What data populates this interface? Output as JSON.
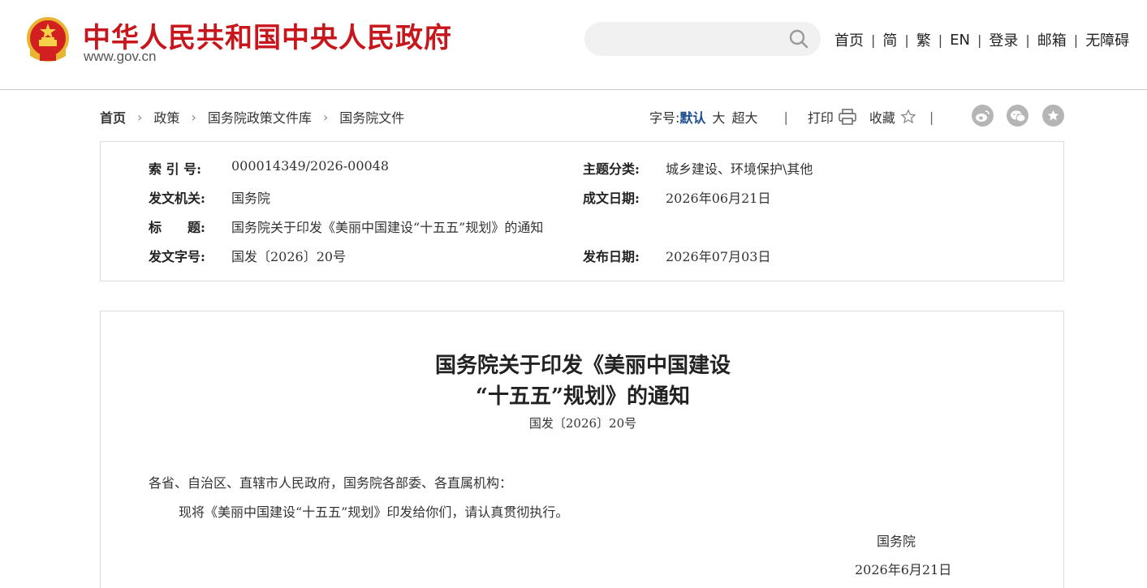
{
  "header": {
    "site_title": "中华人民共和国中央人民政府",
    "domain": "www.gov.cn",
    "search_placeholder": "",
    "nav": [
      "首页",
      "简",
      "繁",
      "EN",
      "登录",
      "邮箱",
      "无障碍"
    ],
    "nav_separator": "|",
    "accent_color": "#c8161d"
  },
  "breadcrumb": {
    "items": [
      "首页",
      "政策",
      "国务院政策文件库",
      "国务院文件"
    ],
    "arrow": "›"
  },
  "toolbar": {
    "font_size_label": "字号:",
    "font_sizes": [
      "默认",
      "大",
      "超大"
    ],
    "separator": "|",
    "print_label": "打印",
    "favorite_label": "收藏",
    "share_icons": [
      "weibo-icon",
      "wechat-icon",
      "star-share-icon"
    ]
  },
  "info": {
    "index_no_label": "索 引 号:",
    "index_no": "000014349/2026-00048",
    "category_label": "主题分类:",
    "category": "城乡建设、环境保护\\其他",
    "issuer_label": "发文机关:",
    "issuer": "国务院",
    "written_date_label": "成文日期:",
    "written_date": "2026年06月21日",
    "title_label": "标　　题:",
    "title": "国务院关于印发《美丽中国建设“十五五”规划》的通知",
    "doc_no_label": "发文字号:",
    "doc_no": "国发〔2026〕20号",
    "publish_date_label": "发布日期:",
    "publish_date": "2026年07月03日"
  },
  "article": {
    "title_line1": "国务院关于印发《美丽中国建设",
    "title_line2": "“十五五”规划》的通知",
    "doc_no": "国发〔2026〕20号",
    "salutation": "各省、自治区、直辖市人民政府，国务院各部委、各直属机构：",
    "body": "现将《美丽中国建设“十五五”规划》印发给你们，请认真贯彻执行。",
    "signature": "国务院",
    "date": "2026年6月21日"
  }
}
